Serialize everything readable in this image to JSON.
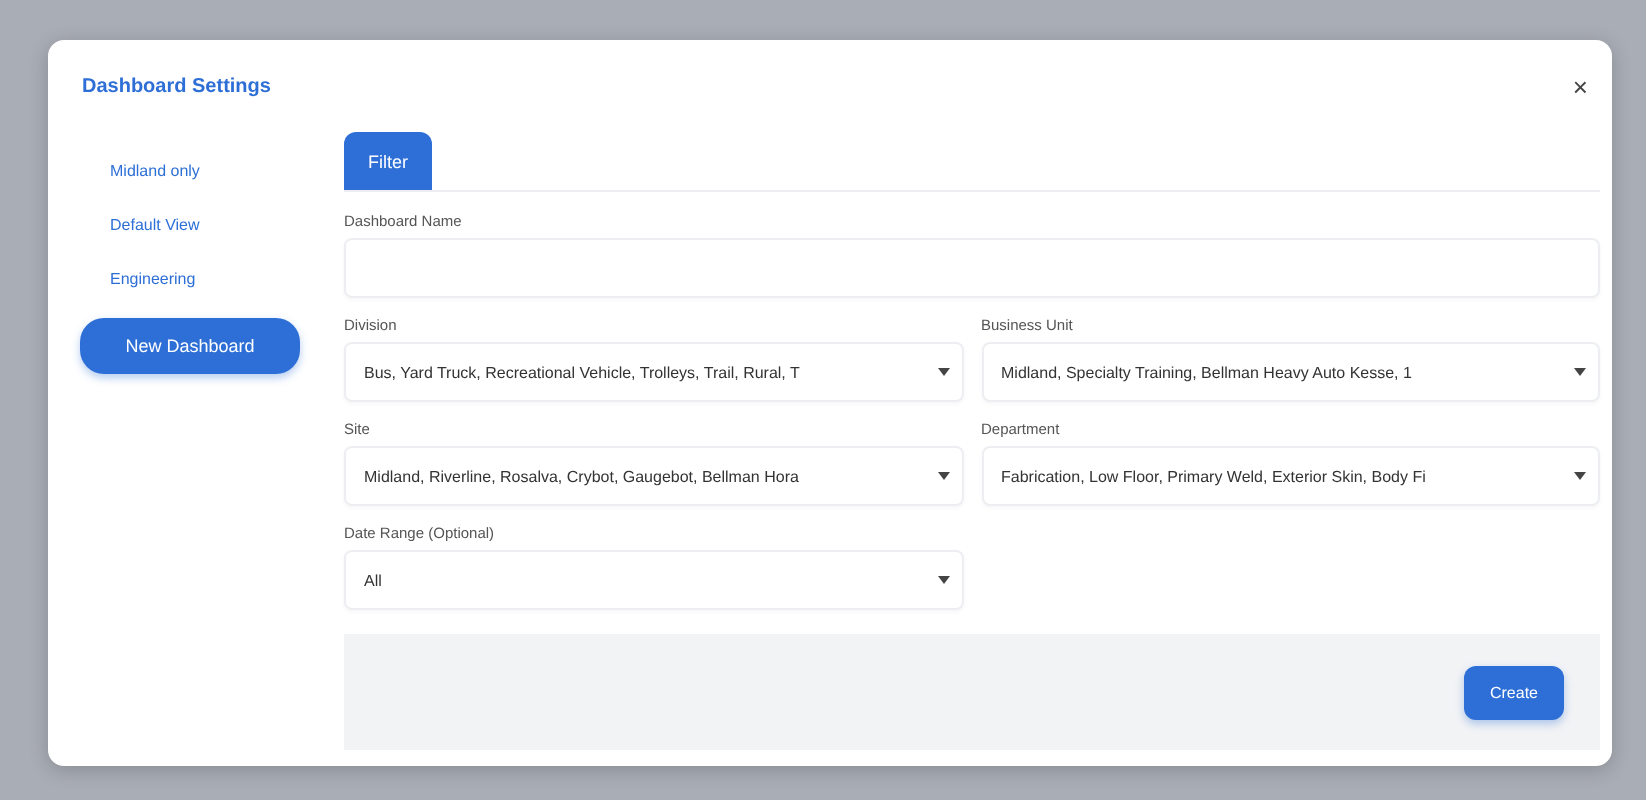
{
  "dialog": {
    "title": "Dashboard Settings",
    "close": "×"
  },
  "sidebar": {
    "items": [
      {
        "label": "Midland only",
        "selected": false
      },
      {
        "label": "Default View",
        "selected": false
      },
      {
        "label": "Engineering",
        "selected": false
      }
    ],
    "new_button": "New Dashboard"
  },
  "tabs": [
    {
      "label": "Filter",
      "selected": true
    }
  ],
  "name_field": {
    "label": "Dashboard Name"
  },
  "filters": [
    {
      "label": "Division",
      "value": "Bus, Yard Truck, Recreational Vehicle, Trolleys, Trail, Rural, T"
    },
    {
      "label": "Business Unit",
      "value": "Midland, Specialty Training, Bellman Heavy Auto Kesse, 1"
    },
    {
      "label": "Site",
      "value": "Midland, Riverline, Rosalva, Crybot, Gaugebot, Bellman Hora"
    },
    {
      "label": "Department",
      "value": "Fabrication, Low Floor, Primary Weld, Exterior Skin, Body Fi"
    }
  ],
  "date_range": {
    "label": "Date Range (Optional)",
    "value": "All"
  },
  "footer": {
    "button": "Create"
  }
}
